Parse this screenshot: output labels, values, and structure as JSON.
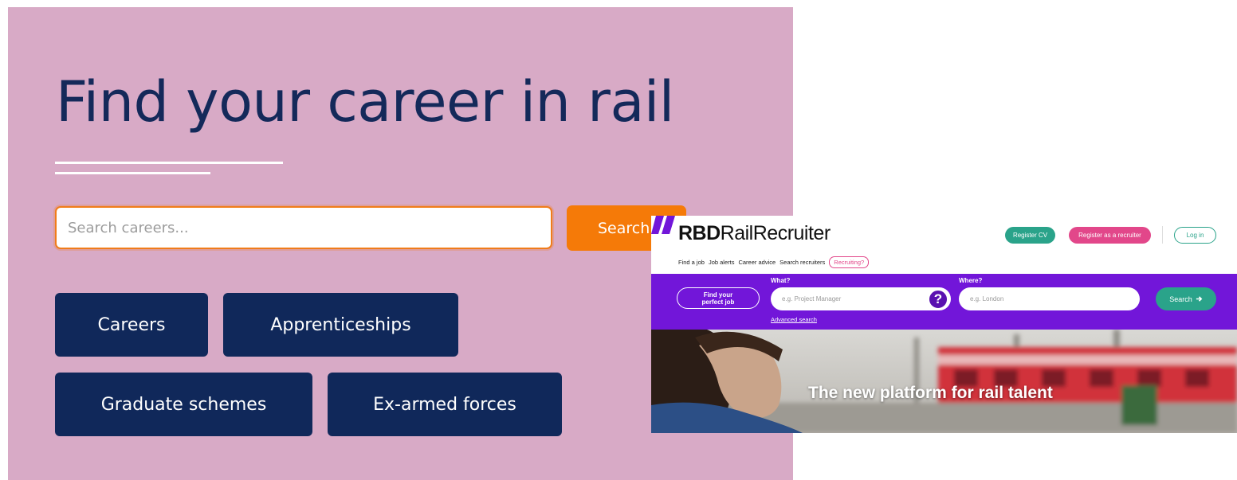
{
  "left_panel": {
    "title": "Find your career in rail",
    "search": {
      "placeholder": "Search careers...",
      "button_label": "Search"
    },
    "categories": [
      "Careers",
      "Apprenticeships",
      "Graduate schemes",
      "Ex-armed forces"
    ],
    "colors": {
      "background": "#d8aac6",
      "title": "#14295a",
      "accent": "#f57a08",
      "button": "#10285a"
    }
  },
  "rbd": {
    "logo": {
      "bold": "RBD",
      "regular": "RailRecruiter"
    },
    "header_buttons": {
      "register_cv": "Register CV",
      "register_recruiter": "Register as a recruiter",
      "login": "Log in"
    },
    "nav": [
      "Find a job",
      "Job alerts",
      "Career advice",
      "Search recruiters",
      "Recruiting?"
    ],
    "search_band": {
      "perfect_job": "Find your\nperfect job",
      "what_label": "What?",
      "what_placeholder": "e.g. Project Manager",
      "where_label": "Where?",
      "where_placeholder": "e.g. London",
      "search_label": "Search",
      "advanced": "Advanced search"
    },
    "hero_text": "The new platform for rail talent",
    "colors": {
      "band": "#7216d9",
      "teal": "#2aa38a",
      "pink": "#e2478a"
    }
  }
}
